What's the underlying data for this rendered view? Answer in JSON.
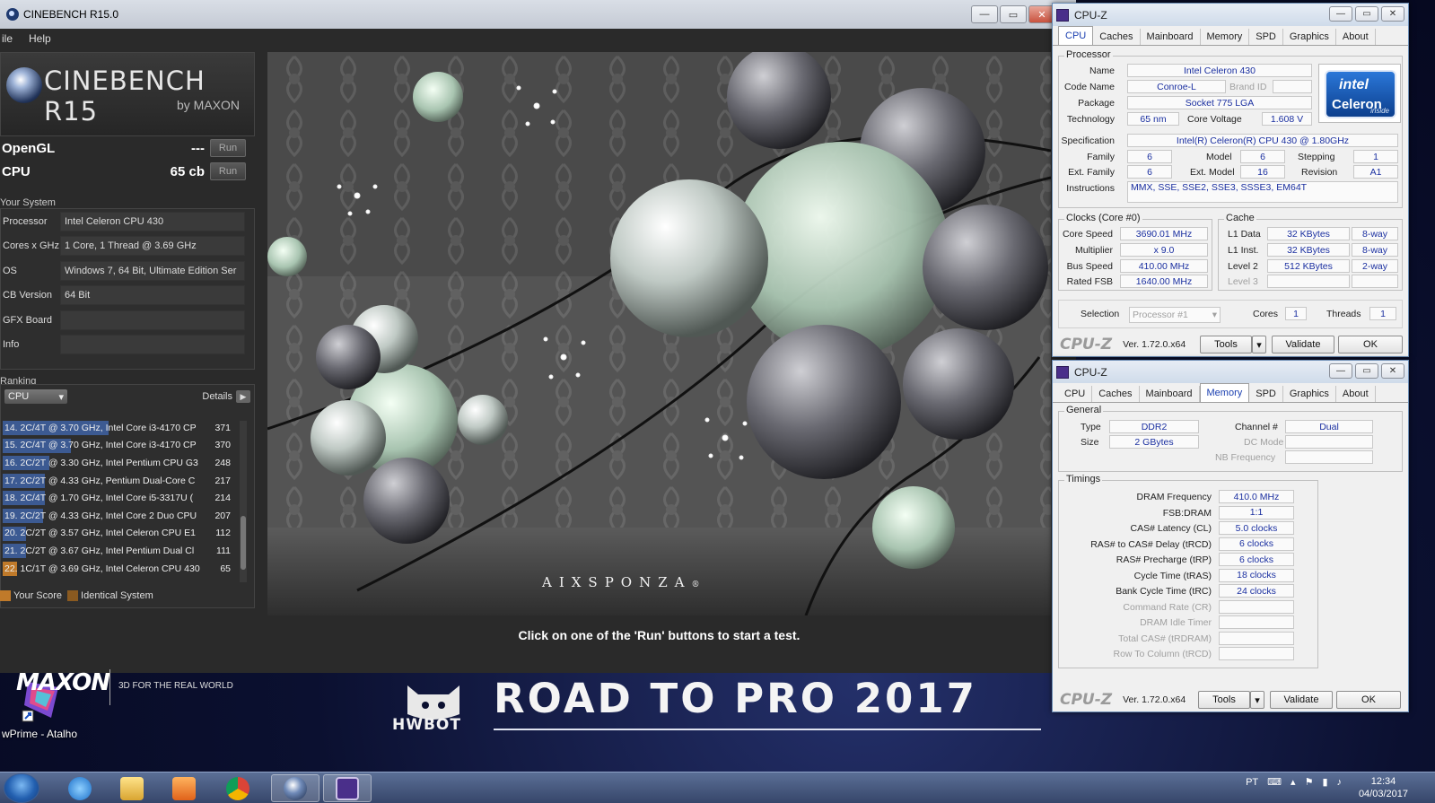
{
  "cinebench": {
    "title": "CINEBENCH R15.0",
    "menu": [
      "ile",
      "Help"
    ],
    "logo_name": "CINEBENCH R15",
    "logo_by": "by MAXON",
    "tests": [
      {
        "label": "OpenGL",
        "value": "---",
        "button": "Run"
      },
      {
        "label": "CPU",
        "value": "65 cb",
        "button": "Run"
      }
    ],
    "your_system_title": "Your System",
    "system": [
      {
        "key": "Processor",
        "value": "Intel Celeron CPU 430"
      },
      {
        "key": "Cores x GHz",
        "value": "1 Core, 1 Thread @ 3.69 GHz"
      },
      {
        "key": "OS",
        "value": "Windows 7, 64 Bit, Ultimate Edition Ser"
      },
      {
        "key": "CB Version",
        "value": "64 Bit"
      },
      {
        "key": "GFX Board",
        "value": ""
      },
      {
        "key": "Info",
        "value": ""
      }
    ],
    "ranking_title": "Ranking",
    "ranking_select": "CPU",
    "ranking_details": "Details",
    "ranking": [
      {
        "text": "14. 2C/4T @ 3.70 GHz, Intel Core i3-4170 CP",
        "score": "371",
        "fraction": 0.45,
        "mine": false
      },
      {
        "text": "15. 2C/4T @ 3.70 GHz, Intel Core i3-4170 CP",
        "score": "370",
        "fraction": 0.29,
        "mine": false
      },
      {
        "text": "16. 2C/2T @ 3.30 GHz, Intel Pentium CPU G3",
        "score": "248",
        "fraction": 0.2,
        "mine": false
      },
      {
        "text": "17. 2C/2T @ 4.33 GHz, Pentium Dual-Core C",
        "score": "217",
        "fraction": 0.18,
        "mine": false
      },
      {
        "text": "18. 2C/4T @ 1.70 GHz,  Intel Core i5-3317U (",
        "score": "214",
        "fraction": 0.18,
        "mine": false
      },
      {
        "text": "19. 2C/2T @ 4.33 GHz, Intel Core 2 Duo CPU",
        "score": "207",
        "fraction": 0.17,
        "mine": false
      },
      {
        "text": "20. 2C/2T @ 3.57 GHz, Intel Celeron CPU E1",
        "score": "112",
        "fraction": 0.1,
        "mine": false
      },
      {
        "text": "21. 2C/2T @ 3.67 GHz, Intel Pentium Dual Cl",
        "score": "111",
        "fraction": 0.1,
        "mine": false
      },
      {
        "text": "22. 1C/1T @ 3.69 GHz, Intel Celeron CPU 430",
        "score": "65",
        "fraction": 0.06,
        "mine": true
      }
    ],
    "legend": {
      "your_score": "Your Score",
      "identical": "Identical System",
      "your_color": "#c07a2a",
      "identical_color": "#8a5a20"
    },
    "maxon": "MAXON",
    "maxon_tag": "3D FOR THE REAL WORLD",
    "render_brand": "AIXSPONZA",
    "render_brand_mark": "®",
    "status": "Click on one of the 'Run' buttons to start a test."
  },
  "cpuz_cpu": {
    "title": "CPU-Z",
    "tabs": [
      "CPU",
      "Caches",
      "Mainboard",
      "Memory",
      "SPD",
      "Graphics",
      "About"
    ],
    "active_tab": "CPU",
    "processor": {
      "group": "Processor",
      "name_label": "Name",
      "name": "Intel Celeron 430",
      "code_label": "Code Name",
      "code": "Conroe-L",
      "brand_label": "Brand ID",
      "package_label": "Package",
      "package": "Socket 775 LGA",
      "tech_label": "Technology",
      "tech": "65 nm",
      "voltage_label": "Core Voltage",
      "voltage": "1.608 V",
      "spec_label": "Specification",
      "spec": "Intel(R) Celeron(R) CPU        430  @ 1.80GHz",
      "family_label": "Family",
      "family": "6",
      "model_label": "Model",
      "model": "6",
      "stepping_label": "Stepping",
      "stepping": "1",
      "extfamily_label": "Ext. Family",
      "extfamily": "6",
      "extmodel_label": "Ext. Model",
      "extmodel": "16",
      "revision_label": "Revision",
      "revision": "A1",
      "instr_label": "Instructions",
      "instr": "MMX, SSE, SSE2, SSE3, SSSE3, EM64T"
    },
    "logo": {
      "intel": "intel",
      "celeron": "Celeron",
      "inside": "inside"
    },
    "clocks": {
      "group": "Clocks (Core #0)",
      "core_label": "Core Speed",
      "core": "3690.01 MHz",
      "mult_label": "Multiplier",
      "mult": "x 9.0",
      "bus_label": "Bus Speed",
      "bus": "410.00 MHz",
      "fsb_label": "Rated FSB",
      "fsb": "1640.00 MHz"
    },
    "cache": {
      "group": "Cache",
      "l1d_label": "L1 Data",
      "l1d": "32 KBytes",
      "l1d_way": "8-way",
      "l1i_label": "L1 Inst.",
      "l1i": "32 KBytes",
      "l1i_way": "8-way",
      "l2_label": "Level 2",
      "l2": "512 KBytes",
      "l2_way": "2-way",
      "l3_label": "Level 3"
    },
    "selection_label": "Selection",
    "selection": "Processor #1",
    "cores_label": "Cores",
    "cores": "1",
    "threads_label": "Threads",
    "threads": "1",
    "brand": "CPU-Z",
    "version": "Ver. 1.72.0.x64",
    "tools": "Tools",
    "validate": "Validate",
    "ok": "OK"
  },
  "cpuz_mem": {
    "title": "CPU-Z",
    "tabs": [
      "CPU",
      "Caches",
      "Mainboard",
      "Memory",
      "SPD",
      "Graphics",
      "About"
    ],
    "active_tab": "Memory",
    "general": {
      "group": "General",
      "type_label": "Type",
      "type": "DDR2",
      "size_label": "Size",
      "size": "2 GBytes",
      "channel_label": "Channel #",
      "channel": "Dual",
      "dc_label": "DC Mode",
      "nb_label": "NB Frequency"
    },
    "timings": {
      "group": "Timings",
      "rows": [
        {
          "label": "DRAM Frequency",
          "value": "410.0 MHz",
          "dim": false
        },
        {
          "label": "FSB:DRAM",
          "value": "1:1",
          "dim": false
        },
        {
          "label": "CAS# Latency (CL)",
          "value": "5.0 clocks",
          "dim": false
        },
        {
          "label": "RAS# to CAS# Delay (tRCD)",
          "value": "6 clocks",
          "dim": false
        },
        {
          "label": "RAS# Precharge (tRP)",
          "value": "6 clocks",
          "dim": false
        },
        {
          "label": "Cycle Time (tRAS)",
          "value": "18 clocks",
          "dim": false
        },
        {
          "label": "Bank Cycle Time (tRC)",
          "value": "24 clocks",
          "dim": false
        },
        {
          "label": "Command Rate (CR)",
          "value": "",
          "dim": true
        },
        {
          "label": "DRAM Idle Timer",
          "value": "",
          "dim": true
        },
        {
          "label": "Total CAS# (tRDRAM)",
          "value": "",
          "dim": true
        },
        {
          "label": "Row To Column (tRCD)",
          "value": "",
          "dim": true
        }
      ]
    },
    "brand": "CPU-Z",
    "version": "Ver. 1.72.0.x64",
    "tools": "Tools",
    "validate": "Validate",
    "ok": "OK"
  },
  "desktop": {
    "icon_label": "wPrime - Atalho",
    "banner_title": "ROAD TO PRO 2017",
    "banner_logo": "HWBOT"
  },
  "taskbar": {
    "apps": [
      "start-orb",
      "internet-explorer-icon",
      "explorer-icon",
      "media-player-icon",
      "chrome-icon",
      "cinebench-icon",
      "cpuz-icon"
    ],
    "lang": "PT",
    "time": "12:34",
    "date": "04/03/2017"
  }
}
